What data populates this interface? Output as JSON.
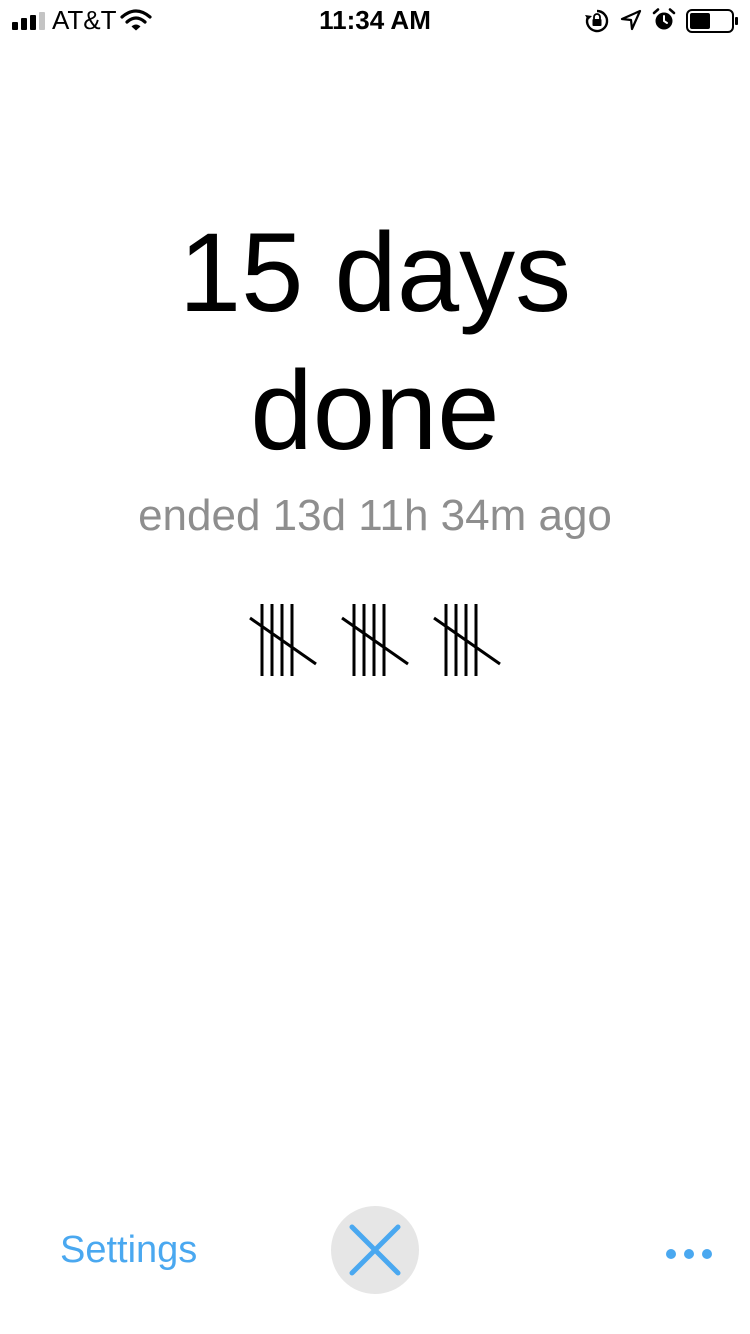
{
  "status_bar": {
    "carrier": "AT&T",
    "time": "11:34 AM",
    "signal_bars": 3,
    "signal_bars_total": 4,
    "battery_level": 0.5,
    "icons": [
      "signal-icon",
      "wifi-icon",
      "rotation-lock-icon",
      "location-icon",
      "alarm-icon",
      "battery-icon"
    ]
  },
  "main": {
    "headline_line1": "15 days",
    "headline_line2": "done",
    "subtitle": "ended 13d 11h 34m ago",
    "tally_groups": 3,
    "tally_marks_per_group": 5
  },
  "toolbar": {
    "settings_label": "Settings",
    "close_icon": "close-icon",
    "more_icon": "more-icon"
  },
  "colors": {
    "accent": "#4aa8f0",
    "subtitle": "#8e8e8e",
    "close_bg": "#e6e6e6",
    "text": "#000000"
  }
}
